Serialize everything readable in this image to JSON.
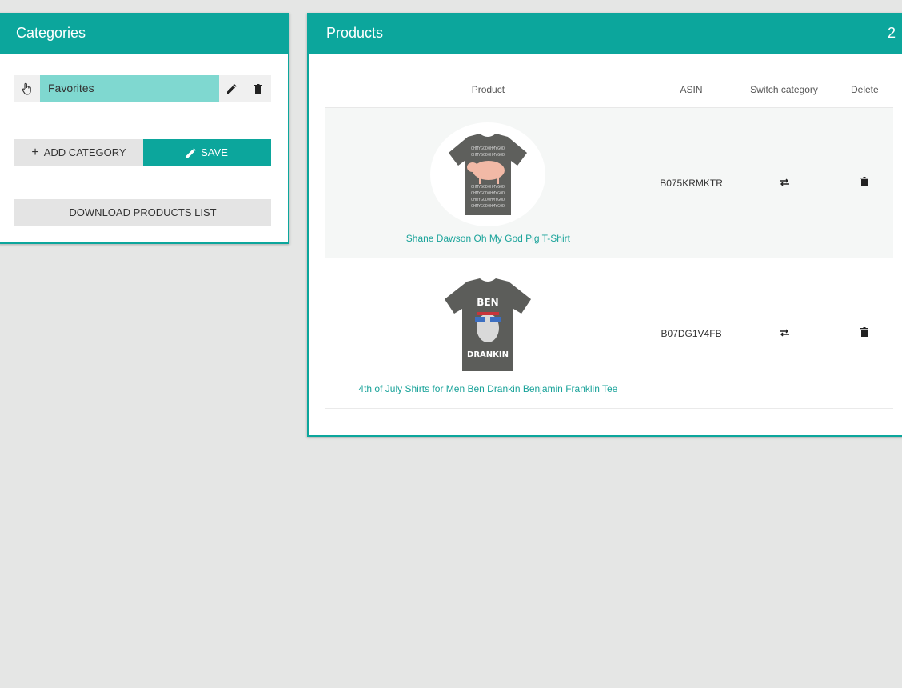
{
  "categories": {
    "title": "Categories",
    "items": [
      {
        "label": "Favorites"
      }
    ],
    "add_label": "Add Category",
    "save_label": "Save",
    "download_label": "Download Products List"
  },
  "products": {
    "title": "Products",
    "count": "2",
    "columns": {
      "product": "Product",
      "asin": "ASIN",
      "switch": "Switch category",
      "delete": "Delete"
    },
    "rows": [
      {
        "name": "Shane Dawson Oh My God Pig T-Shirt",
        "asin": "B075KRMKTR"
      },
      {
        "name": "4th of July Shirts for Men Ben Drankin Benjamin Franklin Tee",
        "asin": "B07DG1V4FB"
      }
    ],
    "shirt2_text_top": "BEN",
    "shirt2_text_bottom": "DRANKIN",
    "shirt1_pattern": "OHMYGODOHMYGOD"
  },
  "colors": {
    "accent": "#0ca69c",
    "selected": "#7fd8d0",
    "background": "#e5e6e5"
  }
}
